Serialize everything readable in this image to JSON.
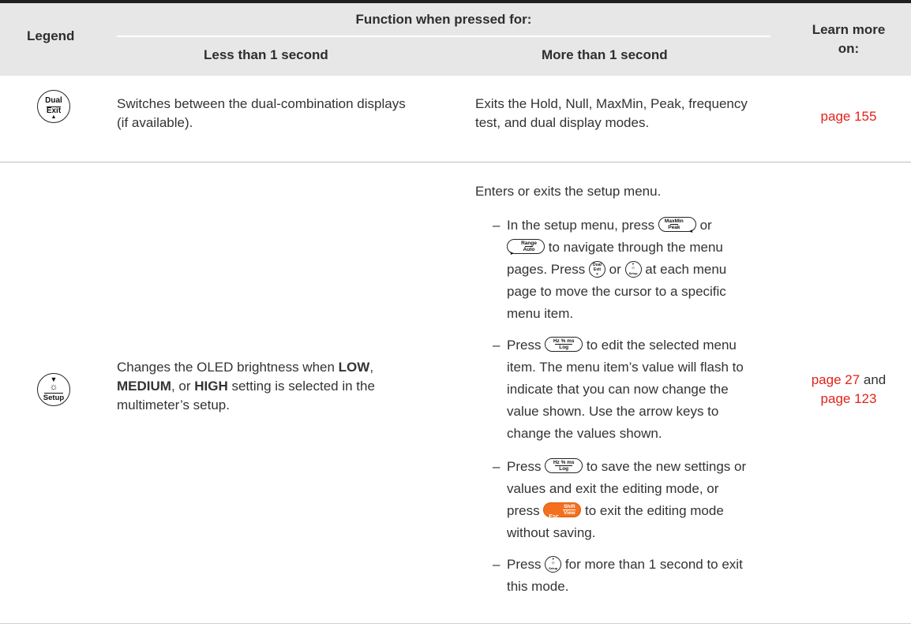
{
  "header": {
    "legend": "Legend",
    "function_title": "Function when pressed for:",
    "less_than": "Less than 1 second",
    "more_than": "More than 1 second",
    "learn_more_1": "Learn more",
    "learn_more_2": "on:"
  },
  "row1": {
    "key": {
      "top": "Dual",
      "bottom": "Exit",
      "arrow": "▲"
    },
    "less_line1": "Switches between the dual-combination displays",
    "less_line2": "(if available).",
    "more_line1": "Exits the Hold, Null, MaxMin, Peak, frequency",
    "more_line2": "test, and dual display modes.",
    "learn": "page 155"
  },
  "row2": {
    "key": {
      "top_arrow": "▼",
      "sun": "☼",
      "bottom": "Setup"
    },
    "less_line1_a": "Changes the OLED brightness when ",
    "less_low": "LOW",
    "less_comma": ",",
    "less_medium": "MEDIUM",
    "less_or": ", or ",
    "less_high": "HIGH",
    "less_line2_tail": " setting is selected in the",
    "less_line3": "multimeter’s setup.",
    "more_intro": "Enters or exits the setup menu.",
    "b1": {
      "dash": "–",
      "l1a": "In the setup menu, press ",
      "l1b": " or",
      "l2b": " to navigate through the menu",
      "l3a": "pages. Press ",
      "l3b": " or ",
      "l3c": " at each menu",
      "l4": "page to move the cursor to a specific",
      "l5": "menu item."
    },
    "b2": {
      "dash": "–",
      "l1a": "Press ",
      "l1b": " to edit the selected menu",
      "l2": "item. The menu item’s value will flash to",
      "l3": "indicate that you can now change the",
      "l4": "value shown. Use the arrow keys to",
      "l5": "change the values shown."
    },
    "b3": {
      "dash": "–",
      "l1a": "Press ",
      "l1b": " to save the new settings or",
      "l2": "values and exit the editing mode, or",
      "l3a": "press ",
      "l3b": " to exit the editing mode",
      "l4": "without saving."
    },
    "b4": {
      "dash": "–",
      "l1a": "Press ",
      "l1b": " for more than 1 second to exit",
      "l2": "this mode."
    },
    "learn_link1": "page 27",
    "learn_and": " and",
    "learn_link2": "page 123"
  },
  "keys": {
    "maxmin": {
      "top": "MaxMin",
      "bottom": "Peak",
      "arrow": "◂"
    },
    "range": {
      "top": "Range",
      "bottom": "Auto",
      "arrow": "▸"
    },
    "hz": {
      "top": "Hz % ms",
      "bottom": "Log"
    },
    "esc": {
      "esc": "Esc",
      "top": "Shift",
      "bottom": "View"
    },
    "dual_small": {
      "top": "Dual",
      "bottom": "Exit",
      "arrow": "▲"
    },
    "setup_small": {
      "top_arrow": "▼",
      "sun": "☼",
      "bottom": "Setup"
    }
  },
  "colors": {
    "link": "#e2231a",
    "header_bg": "#e7e7e7",
    "esc_key": "#f37021"
  }
}
